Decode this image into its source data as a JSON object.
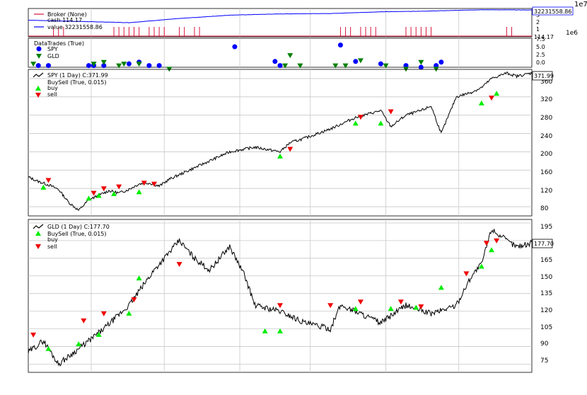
{
  "exponent_top": "1e7",
  "exponent_bottom": "1e6",
  "broker": {
    "legend": [
      "Broker (None)",
      "cash 114.17",
      "value 32231558.86"
    ],
    "value_label": "32231558.86",
    "cash_label": "114.17",
    "yticks": [
      "3",
      "2",
      "1"
    ]
  },
  "trades": {
    "legend": [
      "DataTrades (True)",
      "SPY",
      "GLD"
    ],
    "yticks": [
      "7.5",
      "5.0",
      "2.5",
      "0.0"
    ]
  },
  "spy": {
    "legend": [
      "SPY (1 Day) C:371.99",
      "BuySell (True, 0.015)",
      "buy",
      "sell"
    ],
    "last_label": "371.99",
    "yticks": [
      "360",
      "320",
      "280",
      "240",
      "200",
      "160",
      "120",
      "80"
    ]
  },
  "gld": {
    "legend": [
      "GLD (1 Day) C:177.70",
      "BuySell (True, 0.015)",
      "buy",
      "sell"
    ],
    "last_label": "177.70",
    "yticks": [
      "195",
      "180",
      "165",
      "150",
      "135",
      "120",
      "105",
      "90",
      "75"
    ]
  },
  "colors": {
    "value": "#0000ff",
    "cash": "#d6163b",
    "price": "#000000",
    "buy": "#00ee00",
    "sell": "#ee0000",
    "spy_marker": "#0000ff",
    "gld_marker": "#008000"
  },
  "chart_data": [
    {
      "type": "line",
      "title": "Broker (None)",
      "ylim": [
        0,
        34000000
      ],
      "series": [
        {
          "name": "value",
          "x": [
            0,
            0.1,
            0.2,
            0.3,
            0.4,
            0.5,
            0.6,
            0.7,
            0.8,
            0.9,
            1.0
          ],
          "values": [
            20000000.0,
            18500000.0,
            17000000.0,
            22000000.0,
            26000000.0,
            27500000.0,
            28000000.0,
            30000000.0,
            31000000.0,
            32500000.0,
            32200000.0
          ]
        },
        {
          "name": "cash",
          "x": [
            0,
            1.0
          ],
          "values": [
            114.17,
            114.17
          ]
        }
      ]
    },
    {
      "type": "scatter",
      "title": "DataTrades (True)",
      "ylim": [
        -0.5,
        8
      ],
      "series": [
        {
          "name": "SPY",
          "x": [
            0.02,
            0.04,
            0.12,
            0.13,
            0.15,
            0.2,
            0.22,
            0.24,
            0.26,
            0.41,
            0.49,
            0.5,
            0.62,
            0.65,
            0.7,
            0.75,
            0.78,
            0.81,
            0.82
          ],
          "values": [
            0,
            0,
            0,
            0,
            0,
            0.5,
            1,
            0,
            0,
            5.5,
            1.2,
            0,
            6,
            1.2,
            0.5,
            0,
            -0.5,
            0,
            1
          ]
        },
        {
          "name": "GLD",
          "x": [
            0.01,
            0.13,
            0.15,
            0.18,
            0.19,
            0.22,
            0.28,
            0.51,
            0.52,
            0.54,
            0.61,
            0.63,
            0.66,
            0.71,
            0.75,
            0.78,
            0.81
          ],
          "values": [
            0.5,
            0.5,
            1,
            0,
            0.5,
            0.5,
            -1,
            0,
            3,
            0,
            0,
            0,
            1.5,
            0,
            -1,
            1,
            -1
          ]
        }
      ]
    },
    {
      "type": "line",
      "title": "SPY (1 Day) C:371.99",
      "ylim": [
        60,
        380
      ],
      "series": [
        {
          "name": "SPY",
          "x": [
            0,
            0.02,
            0.04,
            0.06,
            0.08,
            0.1,
            0.12,
            0.14,
            0.16,
            0.18,
            0.2,
            0.22,
            0.24,
            0.26,
            0.28,
            0.3,
            0.35,
            0.4,
            0.45,
            0.5,
            0.52,
            0.55,
            0.6,
            0.65,
            0.7,
            0.72,
            0.75,
            0.78,
            0.8,
            0.82,
            0.85,
            0.88,
            0.9,
            0.92,
            0.95,
            0.97,
            1.0
          ],
          "values": [
            145,
            135,
            128,
            118,
            90,
            72,
            95,
            105,
            115,
            110,
            118,
            130,
            132,
            125,
            140,
            150,
            175,
            200,
            210,
            200,
            220,
            230,
            250,
            275,
            290,
            255,
            280,
            290,
            300,
            240,
            320,
            330,
            340,
            360,
            372,
            365,
            372
          ]
        },
        {
          "name": "buy",
          "x": [
            0.03,
            0.12,
            0.14,
            0.17,
            0.22,
            0.5,
            0.65,
            0.7,
            0.9,
            0.93
          ],
          "values": [
            122,
            98,
            104,
            108,
            112,
            190,
            262,
            262,
            306,
            327
          ]
        },
        {
          "name": "sell",
          "x": [
            0.04,
            0.13,
            0.15,
            0.18,
            0.23,
            0.25,
            0.52,
            0.66,
            0.72,
            0.92
          ],
          "values": [
            138,
            110,
            120,
            124,
            132,
            130,
            206,
            276,
            288,
            318
          ]
        }
      ]
    },
    {
      "type": "line",
      "title": "GLD (1 Day) C:177.70",
      "ylim": [
        68,
        198
      ],
      "series": [
        {
          "name": "GLD",
          "x": [
            0,
            0.03,
            0.06,
            0.1,
            0.15,
            0.2,
            0.25,
            0.3,
            0.33,
            0.36,
            0.4,
            0.43,
            0.45,
            0.5,
            0.55,
            0.6,
            0.62,
            0.65,
            0.7,
            0.75,
            0.8,
            0.85,
            0.88,
            0.9,
            0.92,
            0.95,
            0.97,
            1.0
          ],
          "values": [
            85,
            95,
            75,
            88,
            105,
            125,
            155,
            180,
            165,
            155,
            175,
            150,
            125,
            120,
            110,
            105,
            125,
            120,
            110,
            125,
            118,
            125,
            150,
            160,
            190,
            180,
            175,
            178
          ]
        },
        {
          "name": "buy",
          "x": [
            0.04,
            0.1,
            0.14,
            0.2,
            0.22,
            0.47,
            0.5,
            0.65,
            0.72,
            0.77,
            0.82,
            0.9,
            0.92
          ],
          "values": [
            88,
            92,
            100,
            118,
            148,
            103,
            103,
            122,
            122,
            123,
            140,
            158,
            172
          ]
        },
        {
          "name": "sell",
          "x": [
            0.01,
            0.11,
            0.15,
            0.21,
            0.3,
            0.5,
            0.6,
            0.66,
            0.74,
            0.78,
            0.87,
            0.91,
            0.93
          ],
          "values": [
            100,
            112,
            118,
            130,
            160,
            125,
            125,
            128,
            128,
            124,
            152,
            178,
            180
          ]
        }
      ]
    }
  ]
}
